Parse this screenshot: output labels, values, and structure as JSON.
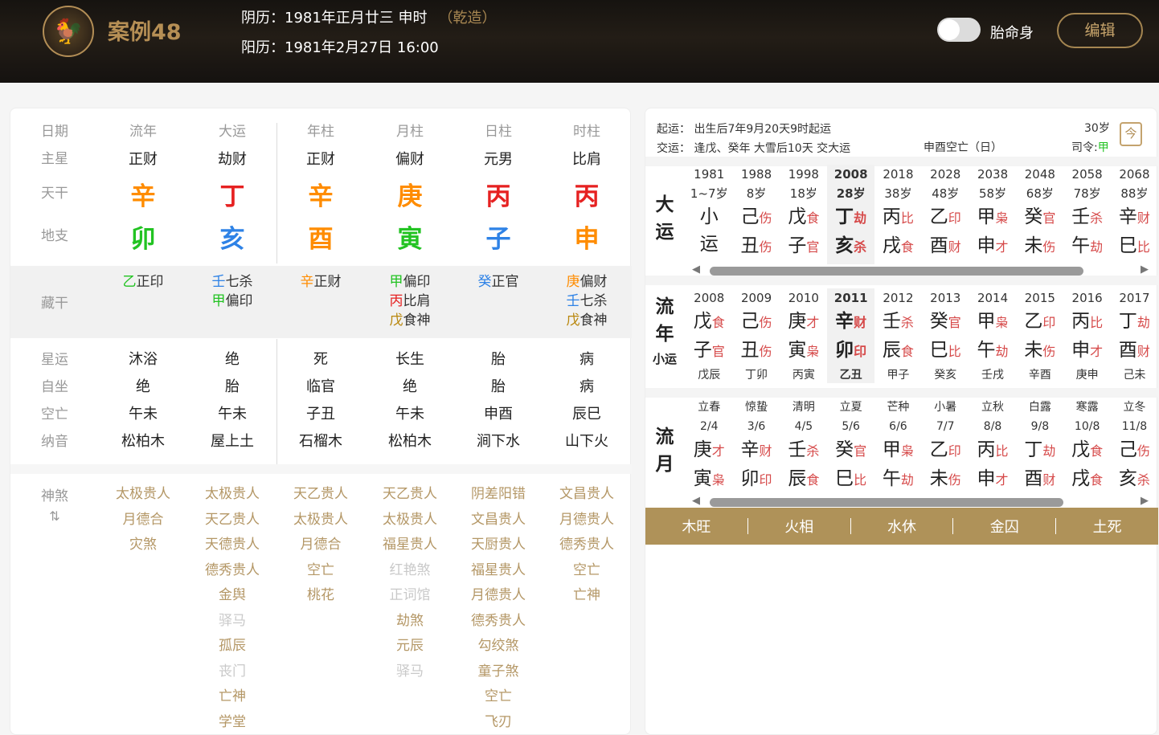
{
  "header": {
    "logo_icon": "rooster-icon",
    "logo_glyph": "🐓",
    "title": "案例48",
    "lunar": "阴历：1981年正月廿三 申时",
    "qian": "（乾造）",
    "solar": "阳历：1981年2月27日 16:00",
    "toggle_label": "胎命身",
    "edit_label": "编辑"
  },
  "left": {
    "labels": {
      "date": "日期",
      "zhuxing": "主星",
      "tiangan": "天干",
      "dizhi": "地支",
      "canggan": "藏干",
      "xingyun": "星运",
      "zizuo": "自坐",
      "kongwang": "空亡",
      "nayin": "纳音",
      "shensha": "神煞",
      "shensha_icon": "⇅"
    },
    "columns": [
      {
        "head": "流年",
        "zhuxing": "正财",
        "gan": "辛",
        "gan_color": "#ff8c00",
        "zhi": "卯",
        "zhi_color": "#22c322",
        "canggan": [
          {
            "g": "乙",
            "gc": "#22c322",
            "s": "正印"
          }
        ],
        "xingyun": "沐浴",
        "zizuo": "绝",
        "kong": "午未",
        "nayin": "松柏木",
        "shensha": [
          {
            "t": "太极贵人",
            "d": false
          },
          {
            "t": "月德合",
            "d": false
          },
          {
            "t": "灾煞",
            "d": false
          }
        ]
      },
      {
        "head": "大运",
        "zhuxing": "劫财",
        "gan": "丁",
        "gan_color": "#e62121",
        "zhi": "亥",
        "zhi_color": "#2e82e6",
        "canggan": [
          {
            "g": "壬",
            "gc": "#2e82e6",
            "s": "七杀"
          },
          {
            "g": "甲",
            "gc": "#22c322",
            "s": "偏印"
          }
        ],
        "xingyun": "绝",
        "zizuo": "胎",
        "kong": "午未",
        "nayin": "屋上土",
        "shensha": [
          {
            "t": "太极贵人",
            "d": false
          },
          {
            "t": "天乙贵人",
            "d": false
          },
          {
            "t": "天德贵人",
            "d": false
          },
          {
            "t": "德秀贵人",
            "d": false
          },
          {
            "t": "金舆",
            "d": false
          },
          {
            "t": "驿马",
            "d": true
          },
          {
            "t": "孤辰",
            "d": false
          },
          {
            "t": "丧门",
            "d": true
          },
          {
            "t": "亡神",
            "d": false
          },
          {
            "t": "学堂",
            "d": false
          }
        ]
      },
      {
        "head": "年柱",
        "zhuxing": "正财",
        "gan": "辛",
        "gan_color": "#ff8c00",
        "zhi": "酉",
        "zhi_color": "#ff8c00",
        "canggan": [
          {
            "g": "辛",
            "gc": "#ff8c00",
            "s": "正财"
          }
        ],
        "xingyun": "死",
        "zizuo": "临官",
        "kong": "子丑",
        "nayin": "石榴木",
        "shensha": [
          {
            "t": "天乙贵人",
            "d": false
          },
          {
            "t": "太极贵人",
            "d": false
          },
          {
            "t": "月德合",
            "d": false
          },
          {
            "t": "空亡",
            "d": false
          },
          {
            "t": "桃花",
            "d": false
          }
        ]
      },
      {
        "head": "月柱",
        "zhuxing": "偏财",
        "gan": "庚",
        "gan_color": "#ff8c00",
        "zhi": "寅",
        "zhi_color": "#22c322",
        "canggan": [
          {
            "g": "甲",
            "gc": "#22c322",
            "s": "偏印"
          },
          {
            "g": "丙",
            "gc": "#e62121",
            "s": "比肩"
          },
          {
            "g": "戊",
            "gc": "#b8860b",
            "s": "食神"
          }
        ],
        "xingyun": "长生",
        "zizuo": "绝",
        "kong": "午未",
        "nayin": "松柏木",
        "shensha": [
          {
            "t": "天乙贵人",
            "d": false
          },
          {
            "t": "太极贵人",
            "d": false
          },
          {
            "t": "福星贵人",
            "d": false
          },
          {
            "t": "红艳煞",
            "d": true
          },
          {
            "t": "正词馆",
            "d": true
          },
          {
            "t": "劫煞",
            "d": false
          },
          {
            "t": "元辰",
            "d": false
          },
          {
            "t": "驿马",
            "d": true
          }
        ]
      },
      {
        "head": "日柱",
        "zhuxing": "元男",
        "gan": "丙",
        "gan_color": "#e62121",
        "zhi": "子",
        "zhi_color": "#2e82e6",
        "canggan": [
          {
            "g": "癸",
            "gc": "#2e82e6",
            "s": "正官"
          }
        ],
        "xingyun": "胎",
        "zizuo": "胎",
        "kong": "申酉",
        "nayin": "涧下水",
        "shensha": [
          {
            "t": "阴差阳错",
            "d": false
          },
          {
            "t": "文昌贵人",
            "d": false
          },
          {
            "t": "天厨贵人",
            "d": false
          },
          {
            "t": "福星贵人",
            "d": false
          },
          {
            "t": "月德贵人",
            "d": false
          },
          {
            "t": "德秀贵人",
            "d": false
          },
          {
            "t": "勾绞煞",
            "d": false
          },
          {
            "t": "童子煞",
            "d": false
          },
          {
            "t": "空亡",
            "d": false
          },
          {
            "t": "飞刃",
            "d": false
          }
        ]
      },
      {
        "head": "时柱",
        "zhuxing": "比肩",
        "gan": "丙",
        "gan_color": "#e62121",
        "zhi": "申",
        "zhi_color": "#ff8c00",
        "canggan": [
          {
            "g": "庚",
            "gc": "#ff8c00",
            "s": "偏财"
          },
          {
            "g": "壬",
            "gc": "#2e82e6",
            "s": "七杀"
          },
          {
            "g": "戊",
            "gc": "#b8860b",
            "s": "食神"
          }
        ],
        "xingyun": "病",
        "zizuo": "病",
        "kong": "辰巳",
        "nayin": "山下火",
        "shensha": [
          {
            "t": "文昌贵人",
            "d": false
          },
          {
            "t": "月德贵人",
            "d": false
          },
          {
            "t": "德秀贵人",
            "d": false
          },
          {
            "t": "空亡",
            "d": false
          },
          {
            "t": "亡神",
            "d": false
          }
        ]
      }
    ]
  },
  "right": {
    "qiyun": "起运： 出生后7年9月20天9时起运",
    "jiaoyun": "交运： 逢戊、癸年 大雪后10天 交大运",
    "kongwang": "申酉空亡（日）",
    "age": "30岁",
    "siling": "司令:",
    "siling_val": "甲",
    "cal_icon": "calendar-icon",
    "cal_glyph": "今",
    "dayun_label": [
      "大",
      "运"
    ],
    "dayun": [
      {
        "y": "1981",
        "a": "1~7岁",
        "g": "小",
        "gt": "",
        "z": "运",
        "zt": ""
      },
      {
        "y": "1988",
        "a": "8岁",
        "g": "己",
        "gt": "伤",
        "z": "丑",
        "zt": "伤"
      },
      {
        "y": "1998",
        "a": "18岁",
        "g": "戊",
        "gt": "食",
        "z": "子",
        "zt": "官"
      },
      {
        "y": "2008",
        "a": "28岁",
        "g": "丁",
        "gt": "劫",
        "z": "亥",
        "zt": "杀",
        "sel": true
      },
      {
        "y": "2018",
        "a": "38岁",
        "g": "丙",
        "gt": "比",
        "z": "戌",
        "zt": "食"
      },
      {
        "y": "2028",
        "a": "48岁",
        "g": "乙",
        "gt": "印",
        "z": "酉",
        "zt": "财"
      },
      {
        "y": "2038",
        "a": "58岁",
        "g": "甲",
        "gt": "枭",
        "z": "申",
        "zt": "才"
      },
      {
        "y": "2048",
        "a": "68岁",
        "g": "癸",
        "gt": "官",
        "z": "未",
        "zt": "伤"
      },
      {
        "y": "2058",
        "a": "78岁",
        "g": "壬",
        "gt": "杀",
        "z": "午",
        "zt": "劫"
      },
      {
        "y": "2068",
        "a": "88岁",
        "g": "辛",
        "gt": "财",
        "z": "巳",
        "zt": "比"
      }
    ],
    "liunian_label": [
      "流",
      "年"
    ],
    "xiaoyun_label": "小运",
    "liunian": [
      {
        "y": "2008",
        "g": "戊",
        "gt": "食",
        "z": "子",
        "zt": "官",
        "x": "戊辰"
      },
      {
        "y": "2009",
        "g": "己",
        "gt": "伤",
        "z": "丑",
        "zt": "伤",
        "x": "丁卯"
      },
      {
        "y": "2010",
        "g": "庚",
        "gt": "才",
        "z": "寅",
        "zt": "枭",
        "x": "丙寅"
      },
      {
        "y": "2011",
        "g": "辛",
        "gt": "财",
        "z": "卯",
        "zt": "印",
        "x": "乙丑",
        "sel": true
      },
      {
        "y": "2012",
        "g": "壬",
        "gt": "杀",
        "z": "辰",
        "zt": "食",
        "x": "甲子"
      },
      {
        "y": "2013",
        "g": "癸",
        "gt": "官",
        "z": "巳",
        "zt": "比",
        "x": "癸亥"
      },
      {
        "y": "2014",
        "g": "甲",
        "gt": "枭",
        "z": "午",
        "zt": "劫",
        "x": "壬戌"
      },
      {
        "y": "2015",
        "g": "乙",
        "gt": "印",
        "z": "未",
        "zt": "伤",
        "x": "辛酉"
      },
      {
        "y": "2016",
        "g": "丙",
        "gt": "比",
        "z": "申",
        "zt": "才",
        "x": "庚申"
      },
      {
        "y": "2017",
        "g": "丁",
        "gt": "劫",
        "z": "酉",
        "zt": "财",
        "x": "己未"
      }
    ],
    "liuyue_label": [
      "流",
      "月"
    ],
    "liuyue": [
      {
        "j": "立春",
        "d": "2/4",
        "g": "庚",
        "gt": "才",
        "z": "寅",
        "zt": "枭"
      },
      {
        "j": "惊蛰",
        "d": "3/6",
        "g": "辛",
        "gt": "财",
        "z": "卯",
        "zt": "印"
      },
      {
        "j": "清明",
        "d": "4/5",
        "g": "壬",
        "gt": "杀",
        "z": "辰",
        "zt": "食"
      },
      {
        "j": "立夏",
        "d": "5/6",
        "g": "癸",
        "gt": "官",
        "z": "巳",
        "zt": "比"
      },
      {
        "j": "芒种",
        "d": "6/6",
        "g": "甲",
        "gt": "枭",
        "z": "午",
        "zt": "劫"
      },
      {
        "j": "小暑",
        "d": "7/7",
        "g": "乙",
        "gt": "印",
        "z": "未",
        "zt": "伤"
      },
      {
        "j": "立秋",
        "d": "8/8",
        "g": "丙",
        "gt": "比",
        "z": "申",
        "zt": "才"
      },
      {
        "j": "白露",
        "d": "9/8",
        "g": "丁",
        "gt": "劫",
        "z": "酉",
        "zt": "财"
      },
      {
        "j": "寒露",
        "d": "10/8",
        "g": "戊",
        "gt": "食",
        "z": "戌",
        "zt": "食"
      },
      {
        "j": "立冬",
        "d": "11/8",
        "g": "己",
        "gt": "伤",
        "z": "亥",
        "zt": "杀"
      }
    ],
    "wuxing": [
      "木旺",
      "火相",
      "水休",
      "金囚",
      "土死"
    ],
    "scroll_left": "◀",
    "scroll_right": "▶"
  }
}
